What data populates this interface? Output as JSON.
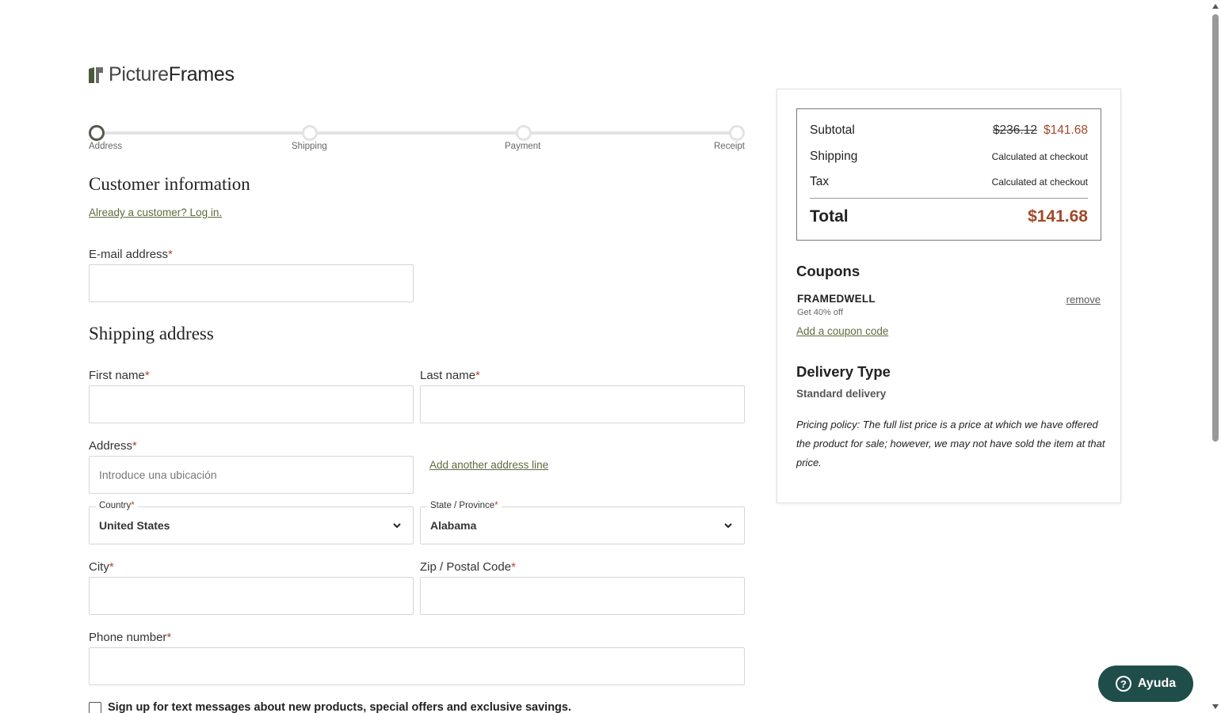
{
  "brand": {
    "name_light": "Picture",
    "name_bold": "Frames"
  },
  "stepper": {
    "steps": [
      {
        "label": "Address"
      },
      {
        "label": "Shipping"
      },
      {
        "label": "Payment"
      },
      {
        "label": "Receipt"
      }
    ],
    "active_step": "Address"
  },
  "customer": {
    "heading": "Customer information",
    "login_link": "Already a customer? Log in.",
    "email_label": "E-mail address",
    "email_value": ""
  },
  "shipping": {
    "heading": "Shipping address",
    "first_name_label": "First name",
    "last_name_label": "Last name",
    "address_label": "Address",
    "address_placeholder": "Introduce una ubicación",
    "add_address_line": "Add another address line",
    "country_label": "Country",
    "country_value": "United States",
    "state_label": "State / Province",
    "state_value": "Alabama",
    "city_label": "City",
    "zip_label": "Zip / Postal Code",
    "phone_label": "Phone number",
    "sms_opt_in": "Sign up for text messages about new products, special offers and exclusive savings.",
    "required_mark": "*"
  },
  "summary": {
    "subtotal_label": "Subtotal",
    "subtotal_original": "$236.12",
    "subtotal_discounted": "$141.68",
    "shipping_label": "Shipping",
    "shipping_value": "Calculated at checkout",
    "tax_label": "Tax",
    "tax_value": "Calculated at checkout",
    "total_label": "Total",
    "total_value": "$141.68"
  },
  "coupons": {
    "heading": "Coupons",
    "code": "FRAMEDWELL",
    "description": "Get 40% off",
    "remove_label": "remove",
    "add_label": "Add a coupon code"
  },
  "delivery": {
    "heading": "Delivery Type",
    "value": "Standard delivery",
    "policy": "Pricing policy: The full list price is a price at which we have offered the product for sale; however, we may not have sold the item at that price."
  },
  "help": {
    "label": "Ayuda",
    "icon": "question-icon"
  },
  "colors": {
    "accent_link": "#5e6b3d",
    "price": "#a0492a",
    "help_button": "#1f4d4a",
    "required": "#b5452b"
  }
}
